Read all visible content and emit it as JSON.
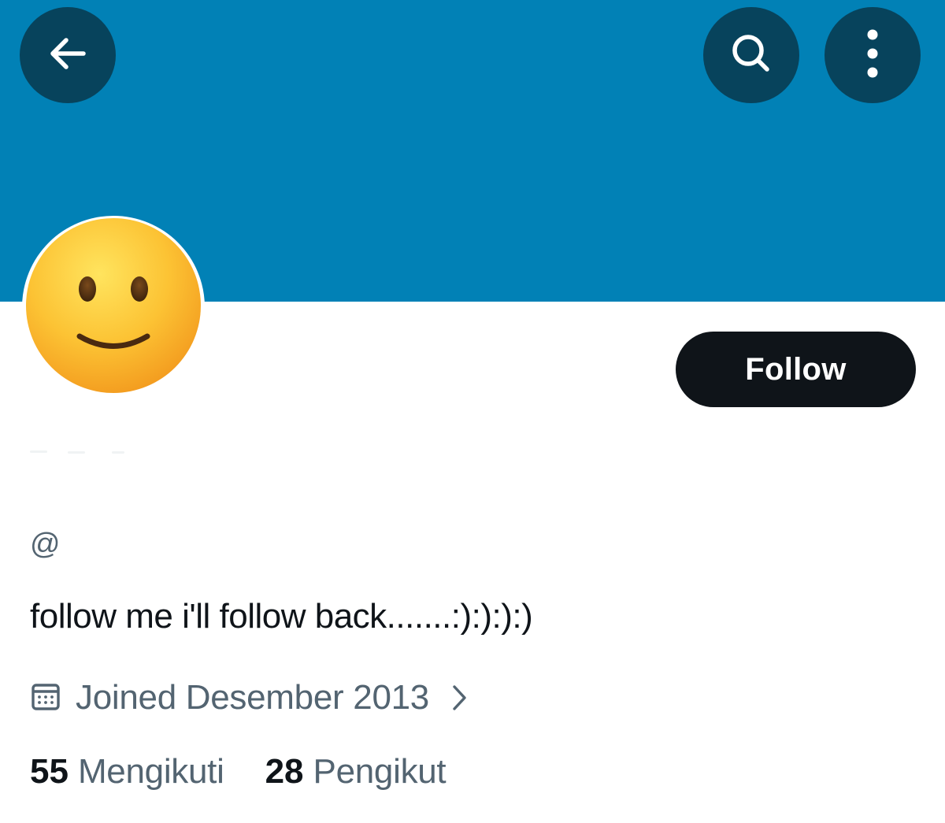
{
  "header": {
    "banner_color": "#0181b6",
    "back_icon": "arrow-left-icon",
    "search_icon": "search-icon",
    "more_icon": "more-vertical-icon"
  },
  "profile": {
    "avatar": "slightly-smiling-face-emoji",
    "follow_label": "Follow",
    "handle": "@",
    "bio": "follow me i'll follow back.......:):):):)",
    "joined_icon": "calendar-icon",
    "joined_text": "Joined Desember 2013",
    "joined_chevron": "chevron-right-icon"
  },
  "stats": {
    "following_count": "55",
    "following_label": "Mengikuti",
    "followers_count": "28",
    "followers_label": "Pengikut"
  }
}
